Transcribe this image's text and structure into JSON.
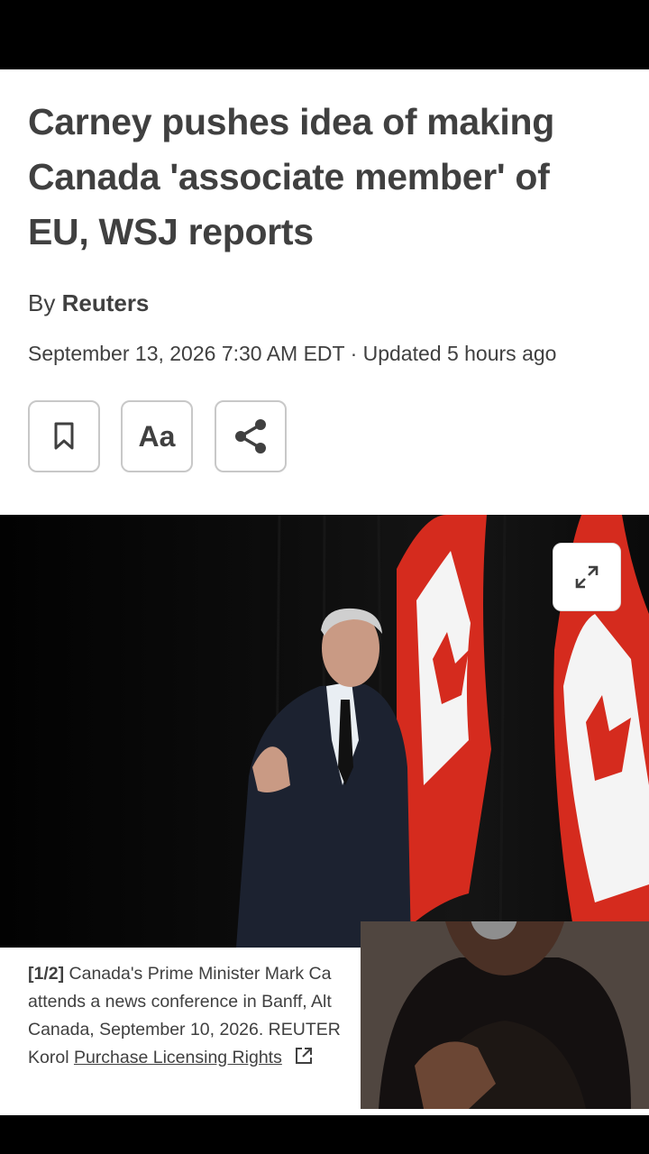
{
  "article": {
    "headline": "Carney pushes idea of making Canada 'associate member' of EU, WSJ reports",
    "byline_prefix": "By",
    "author": "Reuters",
    "dateline": "September 13, 2026 7:30 AM EDT · Updated 5 hours ago"
  },
  "toolbar": {
    "bookmark_icon": "bookmark-icon",
    "text_size_label": "Aa",
    "share_icon": "share-icon"
  },
  "photo": {
    "expand_icon": "expand-icon",
    "caption_index": "[1/2]",
    "caption_line1": "Canada's Prime Minister Mark Ca",
    "caption_line2": "attends a news conference in Banff, Alt",
    "caption_line3": "Canada, September 10, 2026. REUTER",
    "caption_line4": "Korol",
    "licensing_link": "Purchase Licensing Rights",
    "external_link_icon": "external-link-icon"
  },
  "overlay": {
    "type": "picture-in-picture video",
    "content": "woman holding a microphone"
  },
  "colors": {
    "text": "#404040",
    "button_border": "#c8c8c8",
    "flag_red": "#d52b1e"
  }
}
